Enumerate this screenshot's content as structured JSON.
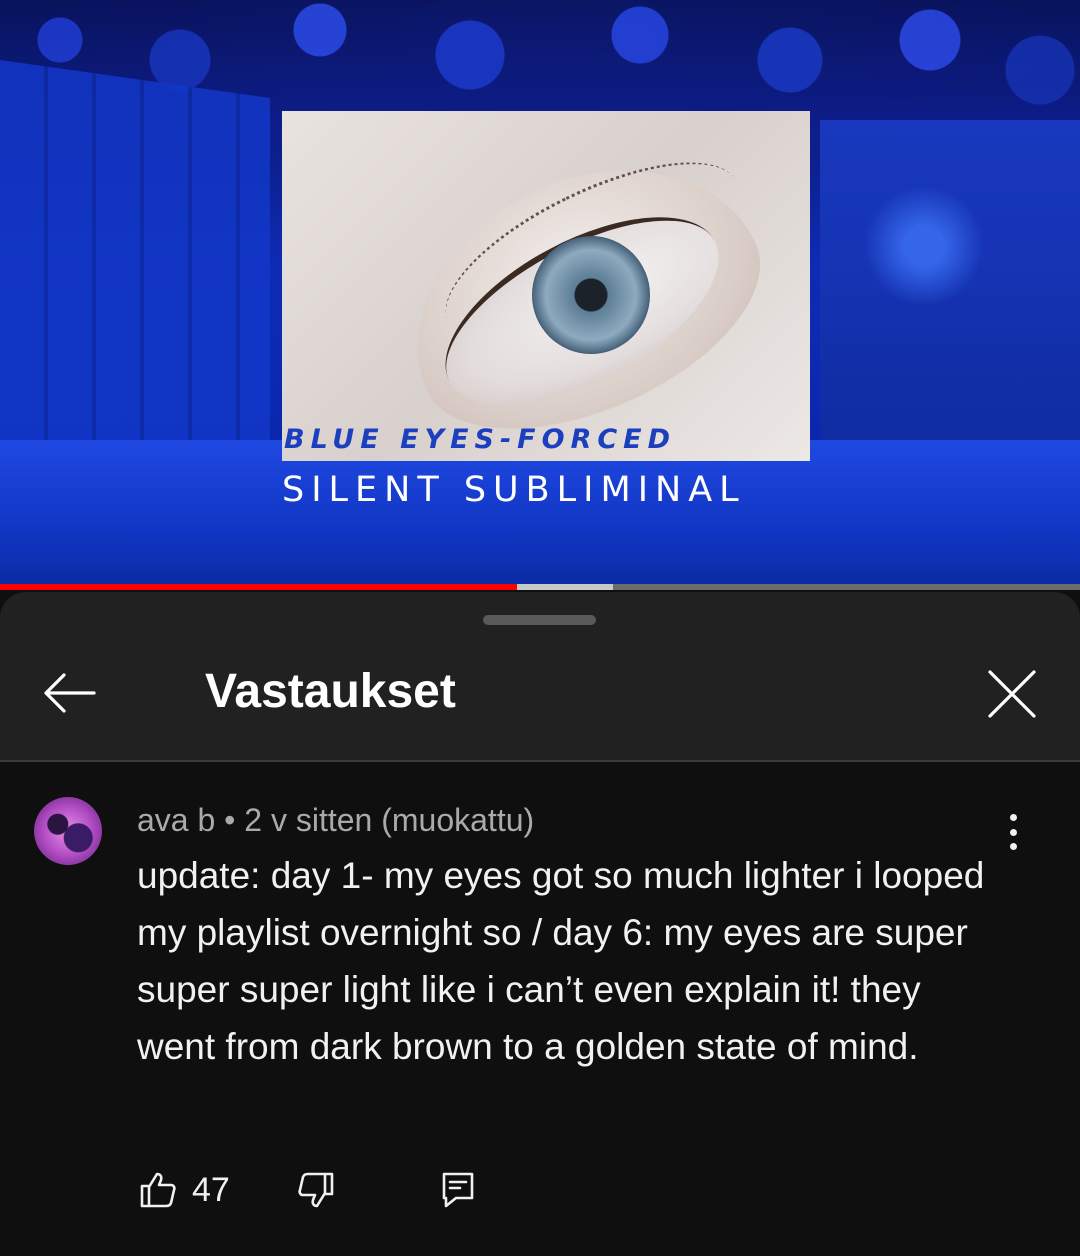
{
  "video": {
    "title_line1": "BLUE EYES-FORCED",
    "title_line2": "SILENT SUBLIMINAL",
    "progress_played": 0.479,
    "progress_buffered": 0.568
  },
  "header": {
    "title": "Vastaukset",
    "back_icon": "arrow-left-icon",
    "close_icon": "close-icon"
  },
  "comment": {
    "author": "ava b",
    "meta": "ava b • 2 v sitten (muokattu)",
    "text": "update: day 1- my eyes got so much lighter i looped my playlist overnight so / day 6: my eyes are super super super light like i can’t even explain it! they went from dark brown to a golden state of mind.",
    "likes": "47",
    "icons": {
      "like": "thumbs-up-icon",
      "dislike": "thumbs-down-icon",
      "reply": "reply-icon",
      "more": "more-vertical-icon"
    }
  },
  "colors": {
    "progress": "#ff0000",
    "header_bg": "#212121",
    "body_bg": "#0f0f0f"
  }
}
